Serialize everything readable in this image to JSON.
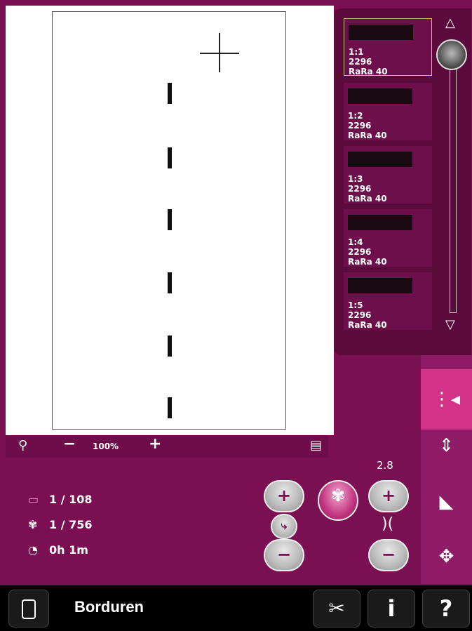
{
  "zoom": {
    "level": "100%",
    "minus": "−",
    "plus": "+"
  },
  "colors": [
    {
      "id": "1:1",
      "code": "2296",
      "thread": "RaRa 40",
      "selected": true
    },
    {
      "id": "1:2",
      "code": "2296",
      "thread": "RaRa 40",
      "selected": false
    },
    {
      "id": "1:3",
      "code": "2296",
      "thread": "RaRa 40",
      "selected": false
    },
    {
      "id": "1:4",
      "code": "2296",
      "thread": "RaRa 40",
      "selected": false
    },
    {
      "id": "1:5",
      "code": "2296",
      "thread": "RaRa 40",
      "selected": false
    }
  ],
  "status": {
    "color_block": "1 / 108",
    "stitch": "1 / 756",
    "time": "0h 1m"
  },
  "controls": {
    "value": "2.8",
    "plus": "+",
    "minus": "−"
  },
  "footer": {
    "title": "Borduren",
    "info": "i",
    "help": "?"
  },
  "colors_theme": {
    "background": "#7a0f52",
    "accent": "#d4338a"
  }
}
